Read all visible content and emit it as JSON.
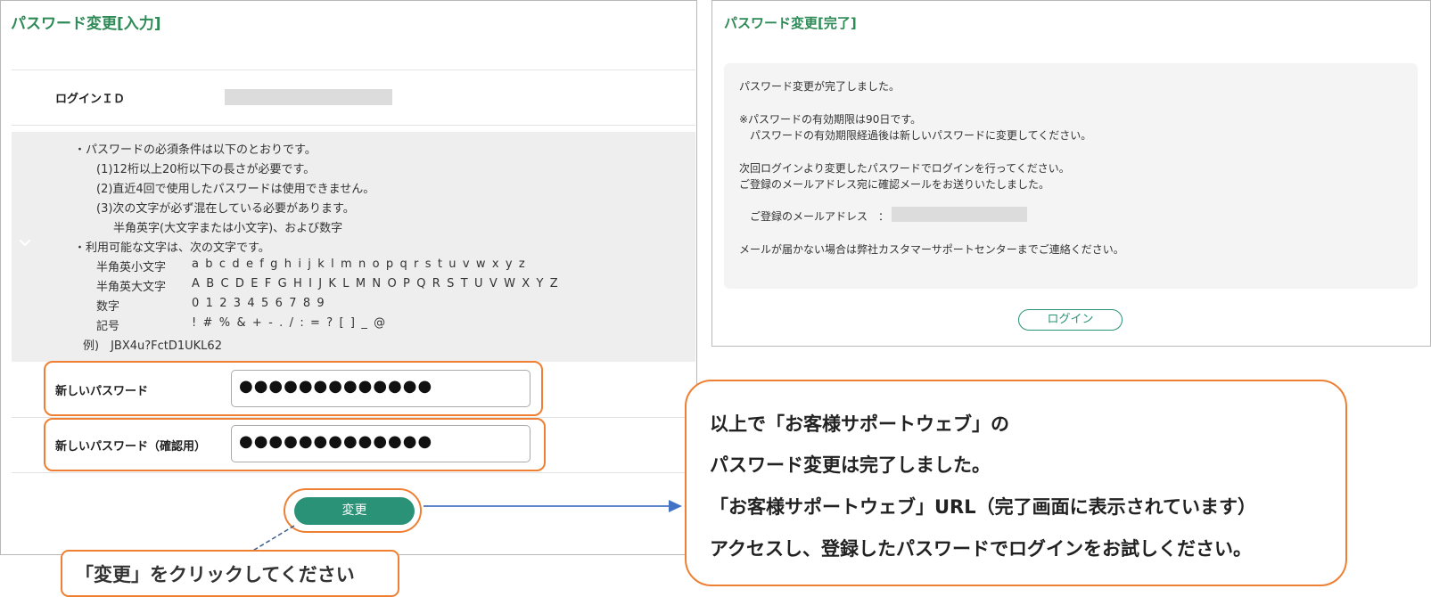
{
  "input_panel": {
    "title": "パスワード変更[入力]",
    "login_id_label": "ログインＩＤ",
    "requirements": {
      "intro": "・パスワードの必須条件は以下のとおりです。",
      "rule1": "(1)12桁以上20桁以下の長さが必要です。",
      "rule2": "(2)直近4回で使用したパスワードは使用できません。",
      "rule3": "(3)次の文字が必ず混在している必要があります。",
      "rule3_detail": "半角英字(大文字または小文字)、および数字",
      "usable_intro": "・利用可能な文字は、次の文字です。",
      "lowercase_label": "半角英小文字",
      "lowercase_chars": "a b c d e f g h i j k l m n o p q r s t u v w x y z",
      "uppercase_label": "半角英大文字",
      "uppercase_chars": "A B C D E F G H I J K L M N O P Q R S T U V W X Y Z",
      "digits_label": "数字",
      "digits_chars": "0 1 2 3 4 5 6 7 8 9",
      "symbols_label": "記号",
      "symbols_chars": "! # % & + - . / : = ? [ ] _ @",
      "example": "例)　JBX4u?FctD1UKL62"
    },
    "new_password_label": "新しいパスワード",
    "new_password_value": "●●●●●●●●●●●●●",
    "confirm_password_label": "新しいパスワード（確認用）",
    "confirm_password_value": "●●●●●●●●●●●●●",
    "change_button": "変更"
  },
  "change_callout": "「変更」をクリックしてください",
  "complete_panel": {
    "title": "パスワード変更[完了]",
    "line1": "パスワード変更が完了しました。",
    "line2": "※パスワードの有効期限は90日です。",
    "line3": "パスワードの有効期限経過後は新しいパスワードに変更してください。",
    "line4": "次回ログインより変更したパスワードでログインを行ってください。",
    "line5": "ご登録のメールアドレス宛に確認メールをお送りいたしました。",
    "email_label": "ご登録のメールアドレス　：",
    "line6": "メールが届かない場合は弊社カスタマーサポートセンターまでご連絡ください。",
    "login_button": "ログイン"
  },
  "info_callout": {
    "line1": "以上で「お客様サポートウェブ」の",
    "line2": "パスワード変更は完了しました。",
    "line3": "「お客様サポートウェブ」URL（完了画面に表示されています）",
    "line4": "アクセスし、登録したパスワードでログインをお試しください。"
  },
  "colors": {
    "brand_green": "#2a9277",
    "title_green": "#2e8b57",
    "highlight_orange": "#ee7f33",
    "arrow_blue": "#4472c4"
  }
}
